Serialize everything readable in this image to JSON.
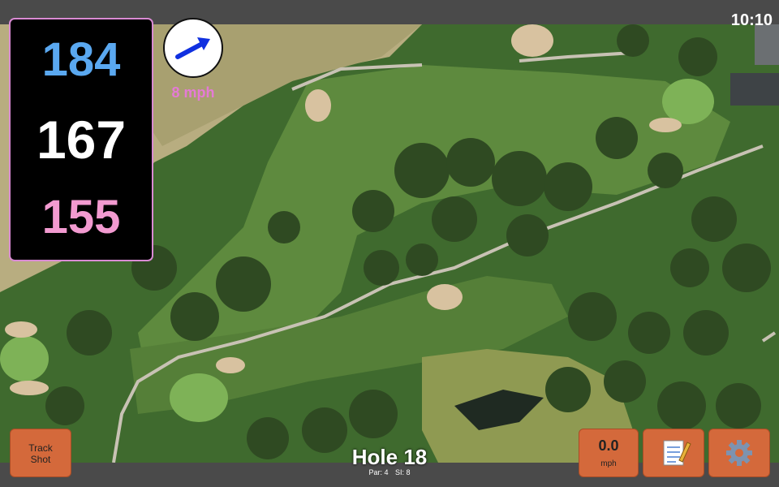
{
  "status": {
    "time": "10:10"
  },
  "distances": {
    "back": "184",
    "middle": "167",
    "front": "155"
  },
  "wind": {
    "speed_label": "8 mph",
    "icon": "wind-direction-arrow-icon"
  },
  "hole": {
    "title": "Hole 18",
    "par_label": "Par: 4",
    "si_label": "SI: 8"
  },
  "buttons": {
    "track_shot": {
      "line1": "Track",
      "line2": "Shot"
    },
    "speed": {
      "value": "0.0",
      "unit": "mph"
    },
    "scorecard_icon": "notepad-icon",
    "settings_icon": "gear-icon"
  },
  "colors": {
    "accent": "#d4693b",
    "back_distance": "#5aa8f0",
    "front_distance": "#f29ad0",
    "wind_label": "#e57ad6"
  }
}
